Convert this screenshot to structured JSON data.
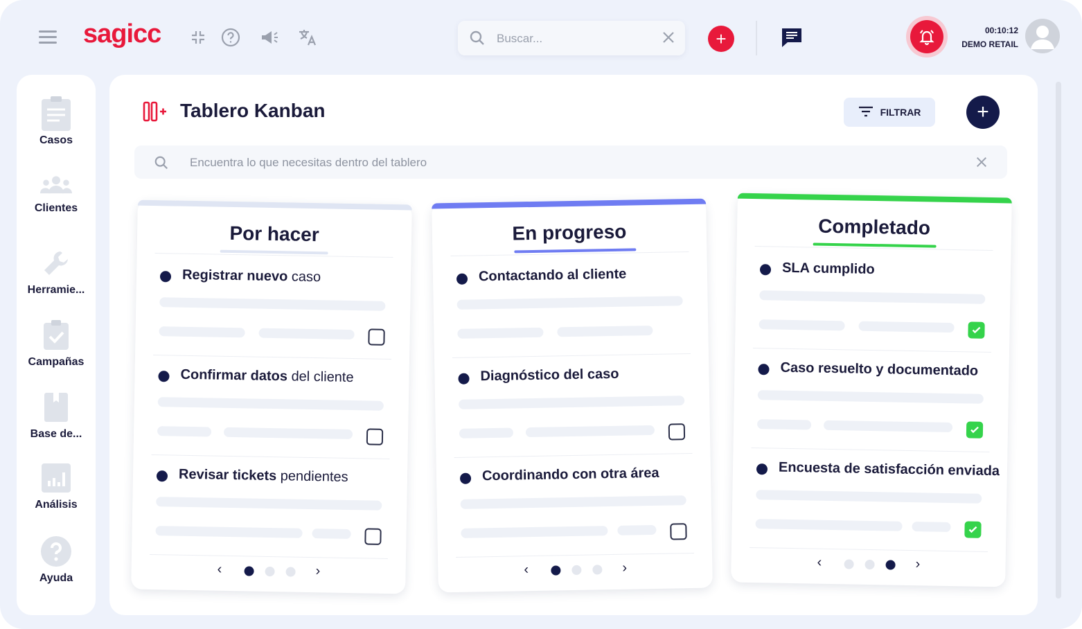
{
  "app": {
    "logo": "sagicc"
  },
  "colors": {
    "brand_red": "#e8193b",
    "navy": "#141a4a",
    "progress_blue": "#6f7cf2",
    "done_green": "#35d34b",
    "todo_gray": "#dfe5f3"
  },
  "topbar": {
    "search_placeholder": "Buscar...",
    "icons": [
      "menu-icon",
      "collapse-icon",
      "help-icon",
      "megaphone-icon",
      "translate-icon",
      "search-icon",
      "close-icon",
      "add-icon",
      "chat-icon",
      "bell-icon",
      "avatar-icon"
    ],
    "timer": "00:10:12",
    "account": "DEMO RETAIL"
  },
  "sidebar": {
    "items": [
      {
        "label": "Casos",
        "icon": "clipboard-icon"
      },
      {
        "label": "Clientes",
        "icon": "users-icon"
      },
      {
        "label": "Herramie...",
        "icon": "wrench-icon"
      },
      {
        "label": "Campañas",
        "icon": "checklist-icon"
      },
      {
        "label": "Base de...",
        "icon": "book-icon"
      },
      {
        "label": "Análisis",
        "icon": "chart-icon"
      },
      {
        "label": "Ayuda",
        "icon": "help-circle-icon"
      }
    ]
  },
  "main": {
    "title": "Tablero Kanban",
    "filter_label": "FILTRAR",
    "board_search_placeholder": "Encuentra lo que necesitas dentro del tablero"
  },
  "columns": [
    {
      "title": "Por hacer",
      "tasks": [
        {
          "name_bold": "Registrar nuevo",
          "name_rest": " caso",
          "checked": false
        },
        {
          "name_bold": "Confirmar datos",
          "name_rest": " del cliente",
          "checked": false
        },
        {
          "name_bold": "Revisar tickets",
          "name_rest": " pendientes",
          "checked": false
        }
      ],
      "page_active": 0
    },
    {
      "title": "En progreso",
      "tasks": [
        {
          "name_bold": "Contactando al cliente",
          "name_rest": "",
          "checked": false
        },
        {
          "name_bold": "Diagnóstico del caso",
          "name_rest": "",
          "checked": false
        },
        {
          "name_bold": "Coordinando con otra área",
          "name_rest": "",
          "checked": false
        }
      ],
      "page_active": 0
    },
    {
      "title": "Completado",
      "tasks": [
        {
          "name_bold": "SLA cumplido",
          "name_rest": "",
          "checked": true
        },
        {
          "name_bold": "Caso resuelto y documentado",
          "name_rest": "",
          "checked": true
        },
        {
          "name_bold": "Encuesta de satisfacción enviada",
          "name_rest": "",
          "checked": true
        }
      ],
      "page_active": 2
    }
  ]
}
